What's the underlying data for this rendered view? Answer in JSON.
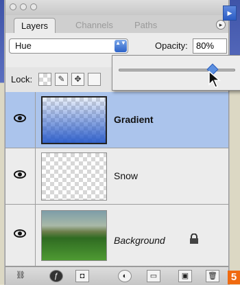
{
  "window": {
    "tabs": [
      "Layers",
      "Channels",
      "Paths"
    ],
    "menu_glyph": "▸"
  },
  "blend": {
    "mode": "Hue",
    "arrows": "▲▼"
  },
  "opacity": {
    "label": "Opacity:",
    "value": "80%",
    "slider_level": 0.8,
    "arrow": "▶"
  },
  "lock": {
    "label": "Lock:",
    "icons": [
      "checker-lock-icon",
      "brush-lock-icon",
      "move-lock-icon",
      "all-lock-icon"
    ]
  },
  "layers": [
    {
      "name": "Gradient",
      "selected": true,
      "italic": false
    },
    {
      "name": "Snow",
      "selected": false,
      "italic": false
    },
    {
      "name": "Background",
      "selected": false,
      "italic": true,
      "locked": true
    }
  ],
  "bottom_icons": [
    "link-icon",
    "fx-icon",
    "mask-icon",
    "adjustment-icon",
    "folder-icon",
    "new-layer-icon",
    "trash-icon"
  ],
  "badge": "5",
  "colors": {
    "selection": "#abc4ec",
    "accent": "#2b5cc4",
    "badge": "#f06a10"
  }
}
